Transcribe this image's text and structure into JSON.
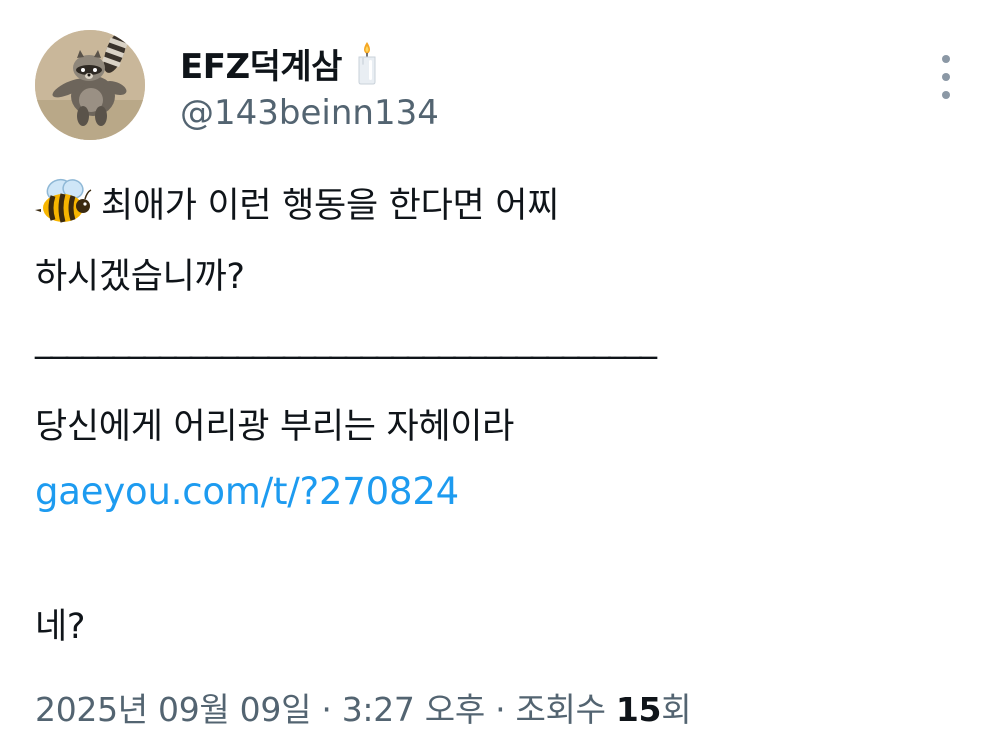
{
  "author": {
    "display_name": "EFZ덕계삼",
    "handle": "@143beinn134",
    "name_icon": "candle-icon",
    "avatar_icon": "raccoon-avatar"
  },
  "menu": {
    "icon": "more-vertical-icon"
  },
  "tweet": {
    "lead_icon": "bee-icon",
    "line1": "최애가 이런 행동을 한다면 어찌",
    "line2": "하시겠습니까?",
    "divider": "________________________________________",
    "line4": "당신에게 어리광 부리는 자헤이라",
    "link": "gaeyou.com/t/?270824",
    "line6": "네?"
  },
  "meta": {
    "date": "2025년 09월 09일",
    "separator": " · ",
    "time": "3:27 오후",
    "views_label": "조회수",
    "views_count": "15",
    "views_suffix": "회"
  },
  "colors": {
    "text": "#0f1419",
    "secondary": "#536471",
    "link": "#1d9bf0"
  }
}
